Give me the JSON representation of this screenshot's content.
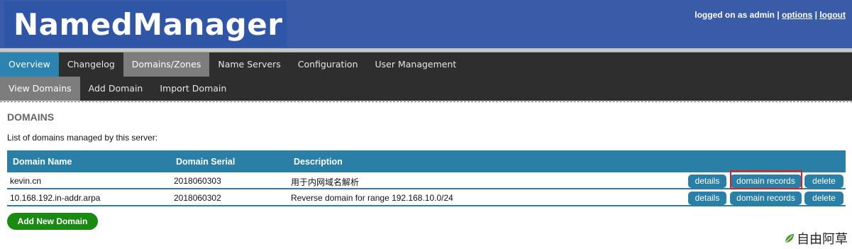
{
  "header": {
    "app_title": "NamedManager",
    "login_text": "logged on as admin",
    "sep1": " | ",
    "options_link": "options",
    "sep2": " | ",
    "logout_link": "logout"
  },
  "nav": {
    "primary": [
      "Overview",
      "Changelog",
      "Domains/Zones",
      "Name Servers",
      "Configuration",
      "User Management"
    ],
    "secondary": [
      "View Domains",
      "Add Domain",
      "Import Domain"
    ]
  },
  "page": {
    "title": "DOMAINS",
    "description": "List of domains managed by this server:"
  },
  "table": {
    "columns": [
      "Domain Name",
      "Domain Serial",
      "Description"
    ],
    "rows": [
      {
        "domain": "kevin.cn",
        "serial": "2018060303",
        "description": "用于内网域名解析"
      },
      {
        "domain": "10.168.192.in-addr.arpa",
        "serial": "2018060302",
        "description": "Reverse domain for range 192.168.10.0/24"
      }
    ],
    "actions": {
      "details": "details",
      "records": "domain records",
      "delete": "delete"
    }
  },
  "add_button": "Add New Domain",
  "watermark": "自由阿草",
  "colors": {
    "header_bg": "#3a5ba8",
    "nav_bg": "#2e2e2e",
    "accent_blue": "#2a7fa6",
    "add_green": "#1a8a13",
    "highlight_red": "#e02020"
  }
}
